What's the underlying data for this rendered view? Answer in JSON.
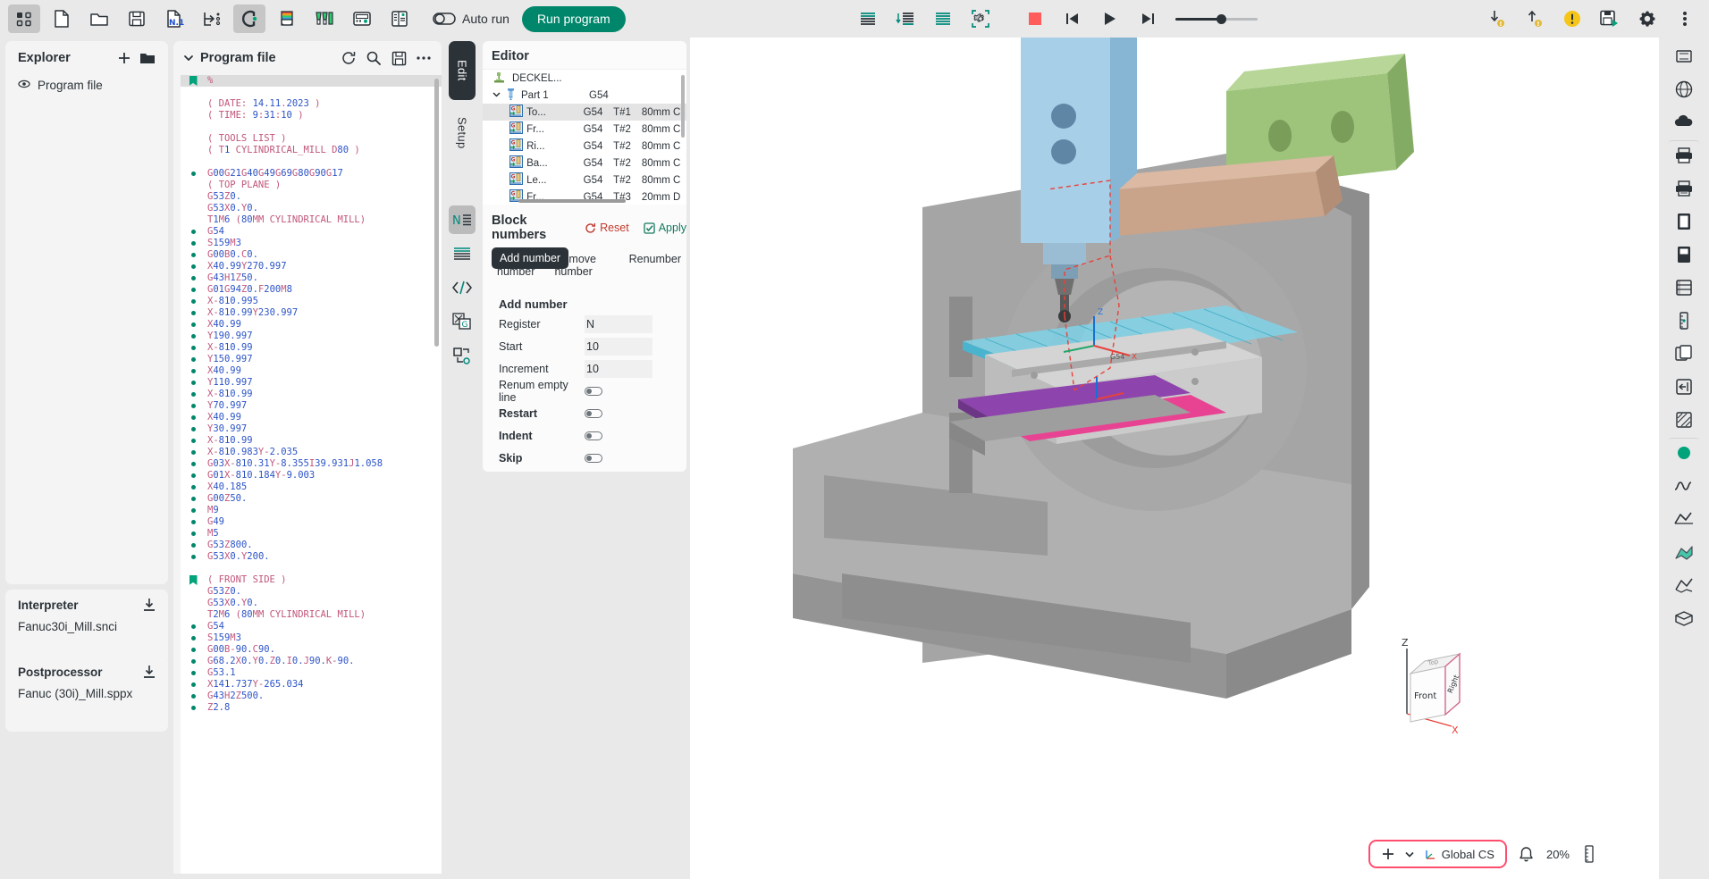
{
  "toolbar": {
    "left_icons": [
      {
        "name": "grid-dots-icon",
        "label": "Workspace"
      },
      {
        "name": "new-file-icon",
        "label": "New"
      },
      {
        "name": "open-folder-icon",
        "label": "Open"
      },
      {
        "name": "save-disk-icon",
        "label": "Save"
      },
      {
        "name": "n1-numbering-icon",
        "label": "N1"
      },
      {
        "name": "export-icon",
        "label": "Export"
      },
      {
        "name": "magnet-icon",
        "label": "Snap"
      },
      {
        "name": "color-stack-icon",
        "label": "Colors"
      },
      {
        "name": "tools-icon",
        "label": "Tools"
      },
      {
        "name": "controller-icon",
        "label": "Controller"
      },
      {
        "name": "list-panel-icon",
        "label": "List"
      }
    ],
    "auto_run_label": "Auto run",
    "run_program_label": "Run program",
    "mid_icons": [
      {
        "name": "align-lines-icon",
        "label": "Lines"
      },
      {
        "name": "sort-lines-icon",
        "label": "Sort"
      },
      {
        "name": "teal-lines-icon",
        "label": "Highlight"
      },
      {
        "name": "gear-bracket-icon",
        "label": "Settings region"
      },
      {
        "name": "stop-icon",
        "label": "Stop"
      },
      {
        "name": "skip-start-icon",
        "label": "Skip to start"
      },
      {
        "name": "play-icon",
        "label": "Play"
      },
      {
        "name": "skip-end-icon",
        "label": "Skip to end"
      }
    ],
    "right_icons": [
      {
        "name": "download-warning-icon",
        "label": "Import with warning"
      },
      {
        "name": "upload-warning-icon",
        "label": "Export with warning"
      },
      {
        "name": "warning-circle-icon",
        "label": "Warnings"
      },
      {
        "name": "save-run-icon",
        "label": "Save and run"
      },
      {
        "name": "gear-icon",
        "label": "Settings"
      },
      {
        "name": "kebab-menu-icon",
        "label": "More"
      }
    ],
    "speed_slider": {
      "name": "speed-slider",
      "value": 55
    }
  },
  "explorer": {
    "title": "Explorer",
    "add_icon": "plus-icon",
    "folder_icon": "folder-icon",
    "items": [
      {
        "label": "Program file",
        "icon": "eye-icon"
      }
    ]
  },
  "interpreter": {
    "title": "Interpreter",
    "value": "Fanuc30i_Mill.snci",
    "icon": "download-icon"
  },
  "postprocessor": {
    "title": "Postprocessor",
    "value": "Fanuc (30i)_Mill.sppx",
    "icon": "download-icon"
  },
  "program_file": {
    "title": "Program file",
    "chevron": "chevron-down-icon",
    "actions": [
      {
        "name": "refresh-icon",
        "label": "Refresh"
      },
      {
        "name": "search-icon",
        "label": "Search"
      },
      {
        "name": "save-icon",
        "label": "Save"
      },
      {
        "name": "more-icon",
        "label": "More"
      }
    ],
    "lines": [
      {
        "marker": "bookmark",
        "text": "%",
        "selected": true
      },
      {
        "marker": "",
        "text": ""
      },
      {
        "marker": "",
        "text": "( DATE: 14.11.2023 )",
        "kind": "comment"
      },
      {
        "marker": "",
        "text": "( TIME: 9:31:10 )",
        "kind": "comment"
      },
      {
        "marker": "",
        "text": ""
      },
      {
        "marker": "",
        "text": "( TOOLS LIST )",
        "kind": "comment"
      },
      {
        "marker": "",
        "text": "( T1 CYLINDRICAL_MILL D80 )",
        "kind": "comment"
      },
      {
        "marker": "",
        "text": ""
      },
      {
        "marker": "dot",
        "text": "G00G21G40G49G69G80G90G17"
      },
      {
        "marker": "",
        "text": "( TOP PLANE )",
        "kind": "comment"
      },
      {
        "marker": "",
        "text": "G53Z0."
      },
      {
        "marker": "",
        "text": "G53X0.Y0."
      },
      {
        "marker": "",
        "text": "T1M6 (80MM CYLINDRICAL MILL)"
      },
      {
        "marker": "dot",
        "text": "G54"
      },
      {
        "marker": "dot",
        "text": "S159M3"
      },
      {
        "marker": "dot",
        "text": "G00B0.C0."
      },
      {
        "marker": "dot",
        "text": "X40.99Y270.997"
      },
      {
        "marker": "dot",
        "text": "G43H1Z50."
      },
      {
        "marker": "dot",
        "text": "G01G94Z0.F200M8"
      },
      {
        "marker": "dot",
        "text": "X-810.995"
      },
      {
        "marker": "dot",
        "text": "X-810.99Y230.997"
      },
      {
        "marker": "dot",
        "text": "X40.99"
      },
      {
        "marker": "dot",
        "text": "Y190.997"
      },
      {
        "marker": "dot",
        "text": "X-810.99"
      },
      {
        "marker": "dot",
        "text": "Y150.997"
      },
      {
        "marker": "dot",
        "text": "X40.99"
      },
      {
        "marker": "dot",
        "text": "Y110.997"
      },
      {
        "marker": "dot",
        "text": "X-810.99"
      },
      {
        "marker": "dot",
        "text": "Y70.997"
      },
      {
        "marker": "dot",
        "text": "X40.99"
      },
      {
        "marker": "dot",
        "text": "Y30.997"
      },
      {
        "marker": "dot",
        "text": "X-810.99"
      },
      {
        "marker": "dot",
        "text": "X-810.983Y-2.035"
      },
      {
        "marker": "dot",
        "text": "G03X-810.31Y-8.355I39.931J1.058"
      },
      {
        "marker": "dot",
        "text": "G01X-810.184Y-9.003"
      },
      {
        "marker": "dot",
        "text": "X40.185"
      },
      {
        "marker": "dot",
        "text": "G00Z50."
      },
      {
        "marker": "dot",
        "text": "M9"
      },
      {
        "marker": "dot",
        "text": "G49"
      },
      {
        "marker": "dot",
        "text": "M5"
      },
      {
        "marker": "dot",
        "text": "G53Z800."
      },
      {
        "marker": "dot",
        "text": "G53X0.Y200."
      },
      {
        "marker": "",
        "text": ""
      },
      {
        "marker": "bookmark",
        "text": "( FRONT SIDE )",
        "kind": "comment"
      },
      {
        "marker": "",
        "text": "G53Z0."
      },
      {
        "marker": "",
        "text": "G53X0.Y0."
      },
      {
        "marker": "",
        "text": "T2M6 (80MM CYLINDRICAL MILL)"
      },
      {
        "marker": "dot",
        "text": "G54"
      },
      {
        "marker": "dot",
        "text": "S159M3"
      },
      {
        "marker": "dot",
        "text": "G00B-90.C90."
      },
      {
        "marker": "dot",
        "text": "G68.2X0.Y0.Z0.I0.J90.K-90."
      },
      {
        "marker": "dot",
        "text": "G53.1"
      },
      {
        "marker": "dot",
        "text": "X141.737Y-265.034"
      },
      {
        "marker": "dot",
        "text": "G43H2Z500."
      },
      {
        "marker": "dot",
        "text": "Z2.8"
      }
    ]
  },
  "editor": {
    "vtabs": [
      {
        "label": "Edit",
        "active": true
      },
      {
        "label": "Setup",
        "active": false
      }
    ],
    "vtools": [
      {
        "name": "block-numbers-icon",
        "label": "N",
        "active": true
      },
      {
        "name": "lines-format-icon",
        "label": "Format",
        "active": false
      },
      {
        "name": "code-brackets-icon",
        "label": "Code",
        "active": false
      },
      {
        "name": "xg-convert-icon",
        "label": "Convert",
        "active": false
      },
      {
        "name": "node-link-icon",
        "label": "Links",
        "active": false
      }
    ],
    "title": "Editor",
    "tree": {
      "root": {
        "label": "DECKEL...",
        "icon": "machine-icon"
      },
      "part": {
        "label": "Part 1",
        "value": "G54",
        "icon": "vise-icon",
        "chevron": "chevron-down-icon"
      },
      "rows": [
        {
          "label": "To...",
          "wcs": "G54",
          "tool": "T#1",
          "desc": "80mm C",
          "selected": true
        },
        {
          "label": "Fr...",
          "wcs": "G54",
          "tool": "T#2",
          "desc": "80mm C",
          "selected": false
        },
        {
          "label": "Ri...",
          "wcs": "G54",
          "tool": "T#2",
          "desc": "80mm C",
          "selected": false
        },
        {
          "label": "Ba...",
          "wcs": "G54",
          "tool": "T#2",
          "desc": "80mm C",
          "selected": false
        },
        {
          "label": "Le...",
          "wcs": "G54",
          "tool": "T#2",
          "desc": "80mm C",
          "selected": false
        },
        {
          "label": "Fr...",
          "wcs": "G54",
          "tool": "T#3",
          "desc": "20mm D",
          "selected": false
        }
      ]
    },
    "block_numbers": {
      "title": "Block numbers",
      "reset_label": "Reset",
      "apply_label": "Apply",
      "tooltip": "Add number",
      "tabs": [
        {
          "label": "Add number",
          "active": true
        },
        {
          "label": "Remove number",
          "active": false
        },
        {
          "label": "Renumber",
          "active": false
        }
      ],
      "form_title": "Add number",
      "fields": [
        {
          "label": "Register",
          "value": "N",
          "type": "text",
          "ellipsis": true
        },
        {
          "label": "Start",
          "value": "10",
          "type": "text"
        },
        {
          "label": "Increment",
          "value": "10",
          "type": "text"
        },
        {
          "label": "Renum empty line",
          "type": "toggle",
          "on": false
        },
        {
          "label": "Restart",
          "type": "toggle",
          "on": false,
          "bold": true
        },
        {
          "label": "Indent",
          "type": "toggle",
          "on": false,
          "bold": true
        },
        {
          "label": "Skip",
          "type": "toggle",
          "on": false,
          "bold": true
        }
      ]
    }
  },
  "viewport": {
    "axis_cube": {
      "labels": {
        "z": "Z",
        "x": "X",
        "front": "Front",
        "right": "Right",
        "top": "Top"
      }
    },
    "global_cs_label": "Global CS",
    "zoom_level": "20%",
    "add_icon": "plus-icon",
    "chevron_icon": "chevron-down-icon",
    "cs_icon": "axes-icon",
    "bell_icon": "bell-icon",
    "ruler_icon": "ruler-icon"
  },
  "right_tools": [
    {
      "name": "stock-box-icon",
      "label": "Stock"
    },
    {
      "name": "sphere-icon",
      "label": "Shaded"
    },
    {
      "name": "cloud-shape-icon",
      "label": "Surface"
    },
    {
      "name": "printer-icon",
      "label": "Print view"
    },
    {
      "name": "printer2-icon",
      "label": "Print setup"
    },
    {
      "name": "panel-icon",
      "label": "Panel"
    },
    {
      "name": "panel2-icon",
      "label": "Panel 2"
    },
    {
      "name": "layers-icon",
      "label": "Layers"
    },
    {
      "name": "measure-icon",
      "label": "Measure"
    },
    {
      "name": "copy-icon",
      "label": "Copy"
    },
    {
      "name": "import-icon",
      "label": "Import"
    },
    {
      "name": "hatch-icon",
      "label": "Section"
    },
    {
      "name": "green-dot-icon",
      "label": "Material"
    },
    {
      "name": "wave-icon",
      "label": "Toolpath"
    },
    {
      "name": "fold-icon",
      "label": "Fold"
    },
    {
      "name": "flag-icon",
      "label": "Flag"
    },
    {
      "name": "flag2-icon",
      "label": "Flag 2"
    },
    {
      "name": "box-open-icon",
      "label": "Box"
    }
  ],
  "colors": {
    "accent_green": "#00876b",
    "teal": "#00897b",
    "red": "#ff5c5c",
    "pink_border": "#ff4d6d",
    "toolbar_bg": "#e9e9e9",
    "panel_bg": "#f4f4f4",
    "code_comment": "#c1557a",
    "code_number": "#2b53c7"
  }
}
